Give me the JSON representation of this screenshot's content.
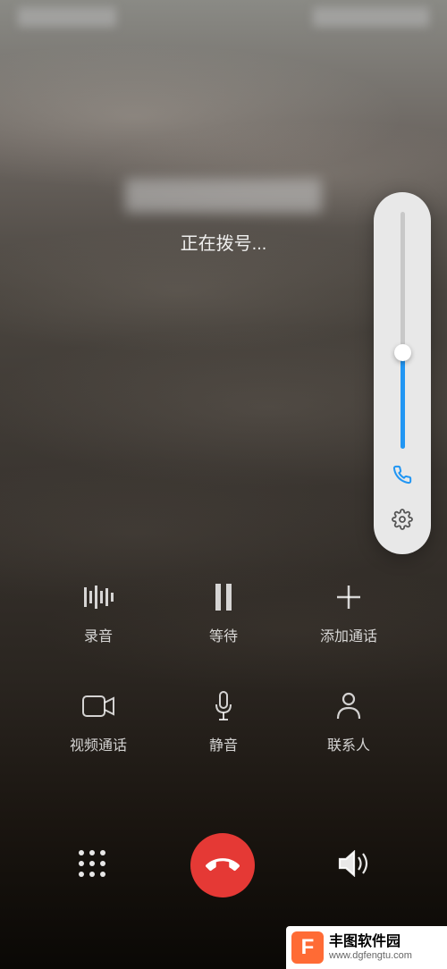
{
  "status_bar": {
    "left_blur": true,
    "right_blur": true
  },
  "call": {
    "status": "正在拨号..."
  },
  "volume": {
    "level_percent": 38
  },
  "actions": {
    "record": "录音",
    "hold": "等待",
    "add_call": "添加通话",
    "video_call": "视频通话",
    "mute": "静音",
    "contacts": "联系人"
  },
  "watermark": {
    "logo_char": "F",
    "title": "丰图软件园",
    "url": "www.dgfengtu.com"
  }
}
